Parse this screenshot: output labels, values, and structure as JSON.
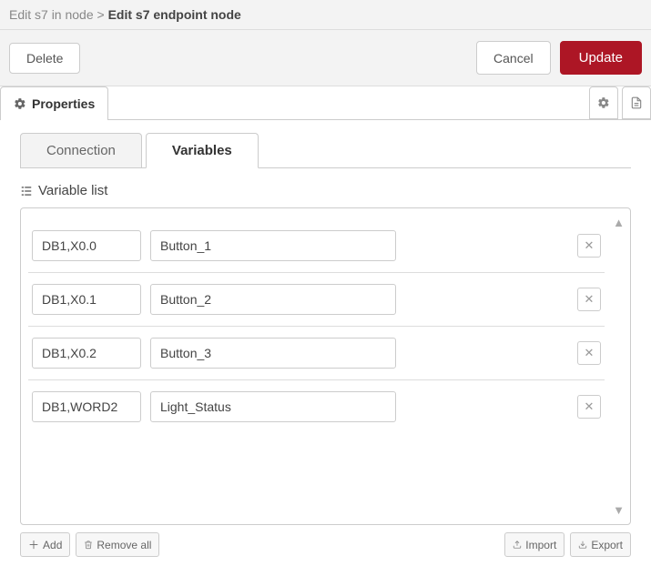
{
  "breadcrumb": {
    "prev": "Edit s7 in node",
    "sep": ">",
    "current": "Edit s7 endpoint node"
  },
  "actions": {
    "delete": "Delete",
    "cancel": "Cancel",
    "update": "Update"
  },
  "mainTab": {
    "properties": "Properties"
  },
  "subTabs": {
    "connection": "Connection",
    "variables": "Variables"
  },
  "listHeader": "Variable list",
  "variables": [
    {
      "addr": "DB1,X0.0",
      "name": "Button_1"
    },
    {
      "addr": "DB1,X0.1",
      "name": "Button_2"
    },
    {
      "addr": "DB1,X0.2",
      "name": "Button_3"
    },
    {
      "addr": "DB1,WORD2",
      "name": "Light_Status"
    }
  ],
  "footer": {
    "add": "Add",
    "removeAll": "Remove all",
    "import": "Import",
    "export": "Export"
  }
}
